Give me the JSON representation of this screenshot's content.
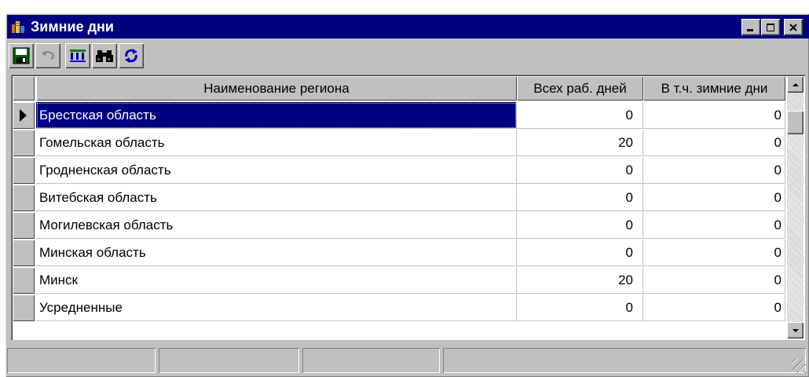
{
  "window": {
    "title": "Зимние дни",
    "icon": "regions-app-icon",
    "controls": [
      "minimize-icon",
      "maximize-icon",
      "close-icon"
    ]
  },
  "toolbar": {
    "buttons": [
      {
        "name": "save",
        "icon": "floppy-disk-icon"
      },
      {
        "name": "undo",
        "icon": "undo-arrow-icon"
      },
      {
        "name": "columns",
        "icon": "grid-columns-icon"
      },
      {
        "name": "find",
        "icon": "binoculars-icon"
      },
      {
        "name": "refresh",
        "icon": "refresh-arrows-icon"
      }
    ]
  },
  "table": {
    "columns": [
      "Наименование региона",
      "Всех раб. дней",
      "В т.ч. зимние дни"
    ],
    "selected_row": 0,
    "rows": [
      {
        "name": "Брестская область",
        "all_days": "0",
        "winter_days": "0"
      },
      {
        "name": "Гомельская область",
        "all_days": "20",
        "winter_days": "0"
      },
      {
        "name": "Гродненская область",
        "all_days": "0",
        "winter_days": "0"
      },
      {
        "name": "Витебская область",
        "all_days": "0",
        "winter_days": "0"
      },
      {
        "name": "Могилевская область",
        "all_days": "0",
        "winter_days": "0"
      },
      {
        "name": "Минская область",
        "all_days": "0",
        "winter_days": "0"
      },
      {
        "name": "Минск",
        "all_days": "20",
        "winter_days": "0"
      },
      {
        "name": "Усредненные",
        "all_days": "0",
        "winter_days": "0"
      }
    ]
  },
  "statusbar": {
    "panels": [
      "",
      "",
      "",
      ""
    ]
  },
  "colors": {
    "titlebar": "#000080",
    "face": "#c0c0c0",
    "selection": "#000080"
  }
}
